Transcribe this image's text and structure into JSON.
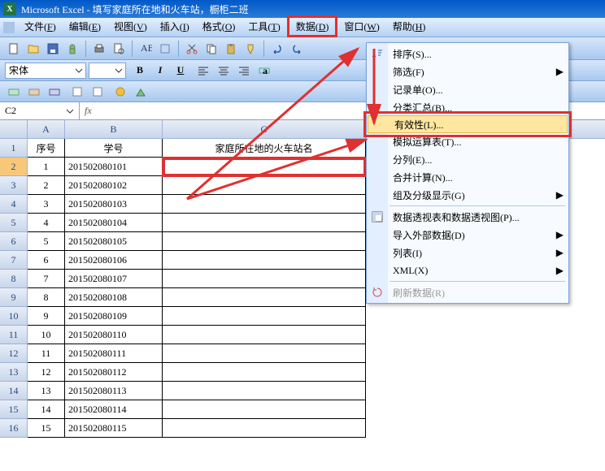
{
  "title": "Microsoft Excel - 填写家庭所在地和火车站，橱柜二班",
  "menubar": [
    {
      "label": "文件",
      "key": "F"
    },
    {
      "label": "编辑",
      "key": "E"
    },
    {
      "label": "视图",
      "key": "V"
    },
    {
      "label": "插入",
      "key": "I"
    },
    {
      "label": "格式",
      "key": "O"
    },
    {
      "label": "工具",
      "key": "T"
    },
    {
      "label": "数据",
      "key": "D",
      "hot": true
    },
    {
      "label": "窗口",
      "key": "W"
    },
    {
      "label": "帮助",
      "key": "H"
    }
  ],
  "font": {
    "name": "宋体",
    "size": ""
  },
  "namebox": "C2",
  "fx": "fx",
  "columns": [
    "A",
    "B",
    "C"
  ],
  "headers": {
    "A": "序号",
    "B": "学号",
    "C": "家庭所在地的火车站名"
  },
  "rows": [
    {
      "n": 1,
      "A": "1",
      "B": "201502080101",
      "C": ""
    },
    {
      "n": 2,
      "A": "2",
      "B": "201502080102",
      "C": ""
    },
    {
      "n": 3,
      "A": "3",
      "B": "201502080103",
      "C": ""
    },
    {
      "n": 4,
      "A": "4",
      "B": "201502080104",
      "C": ""
    },
    {
      "n": 5,
      "A": "5",
      "B": "201502080105",
      "C": ""
    },
    {
      "n": 6,
      "A": "6",
      "B": "201502080106",
      "C": ""
    },
    {
      "n": 7,
      "A": "7",
      "B": "201502080107",
      "C": ""
    },
    {
      "n": 8,
      "A": "8",
      "B": "201502080108",
      "C": ""
    },
    {
      "n": 9,
      "A": "9",
      "B": "201502080109",
      "C": ""
    },
    {
      "n": 10,
      "A": "10",
      "B": "201502080110",
      "C": ""
    },
    {
      "n": 11,
      "A": "11",
      "B": "201502080111",
      "C": ""
    },
    {
      "n": 12,
      "A": "12",
      "B": "201502080112",
      "C": ""
    },
    {
      "n": 13,
      "A": "13",
      "B": "201502080113",
      "C": ""
    },
    {
      "n": 14,
      "A": "14",
      "B": "201502080114",
      "C": ""
    },
    {
      "n": 15,
      "A": "15",
      "B": "201502080115",
      "C": ""
    }
  ],
  "dropdown": [
    {
      "label": "排序(S)...",
      "icon": "sort",
      "top_cut": true
    },
    {
      "label": "筛选(F)",
      "sub": true
    },
    {
      "label": "记录单(O)..."
    },
    {
      "label": "分类汇总(B)..."
    },
    {
      "label": "有效性(L)...",
      "hot": true,
      "highlight": true
    },
    {
      "label": "模拟运算表(T)..."
    },
    {
      "label": "分列(E)..."
    },
    {
      "label": "合并计算(N)..."
    },
    {
      "label": "组及分级显示(G)",
      "sub": true
    },
    {
      "sep": true
    },
    {
      "label": "数据透视表和数据透视图(P)...",
      "icon": "pivot"
    },
    {
      "label": "导入外部数据(D)",
      "sub": true
    },
    {
      "label": "列表(I)",
      "sub": true
    },
    {
      "label": "XML(X)",
      "sub": true
    },
    {
      "sep": true
    },
    {
      "label": "刷新数据(R)",
      "disabled": true,
      "icon": "refresh"
    }
  ],
  "format_buttons": {
    "bold": "B",
    "italic": "I",
    "underline": "U"
  }
}
